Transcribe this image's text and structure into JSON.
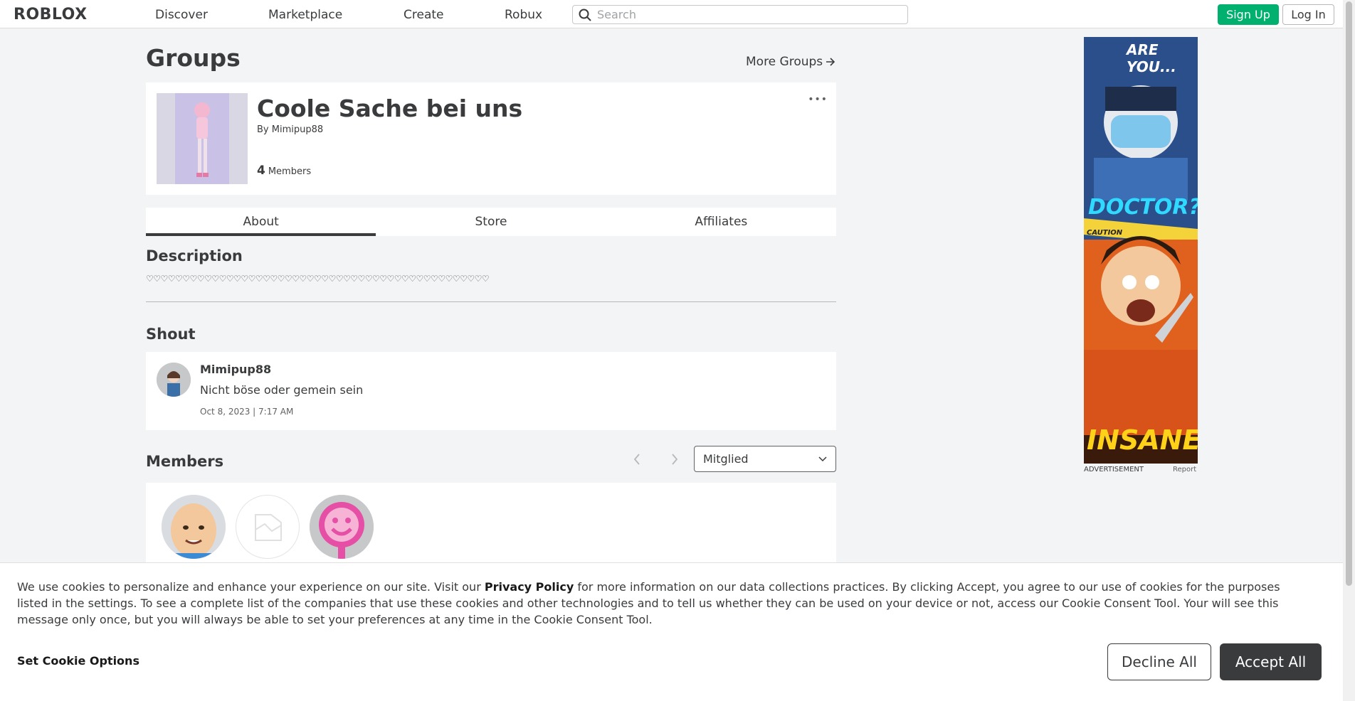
{
  "header": {
    "logo": "ROBLOX",
    "nav": [
      "Discover",
      "Marketplace",
      "Create",
      "Robux"
    ],
    "search_placeholder": "Search",
    "signup_label": "Sign Up",
    "login_label": "Log In"
  },
  "page": {
    "title": "Groups",
    "more_groups": "More Groups"
  },
  "group": {
    "name": "Coole Sache bei uns",
    "by_prefix": "By",
    "owner": "Mimipup88",
    "member_count": "4",
    "members_label": "Members",
    "more_menu": "•••"
  },
  "tabs": [
    "About",
    "Store",
    "Affiliates"
  ],
  "description": {
    "title": "Description",
    "text": "♡♡♡♡♡♡♡♡♡♡♡♡♡♡♡♡♡♡♡♡♡♡♡♡♡♡♡♡♡♡♡♡♡♡♡♡♡♡♡♡♡♡♡♡♡♡♡"
  },
  "shout": {
    "title": "Shout",
    "user": "Mimipup88",
    "message": "Nicht böse oder gemein sein",
    "date": "Oct 8, 2023 | 7:17 AM"
  },
  "members": {
    "title": "Members",
    "role_selected": "Mitglied"
  },
  "ad": {
    "headline_top": "ARE YOU...",
    "headline_mid": "DOCTOR?",
    "headline_bottom": "INSANE?",
    "caution_text": "CAUTION",
    "label": "ADVERTISEMENT",
    "report": "Report"
  },
  "cookie": {
    "text_before": "We use cookies to personalize and enhance your experience on our site. Visit our ",
    "privacy_link": "Privacy Policy",
    "text_after": " for more information on our data collections practices. By clicking Accept, you agree to our use of cookies for the purposes listed in the settings. To see a complete list of the companies that use these cookies and other technologies and to tell us whether they can be used on your device or not, access our Cookie Consent Tool. Your will see this message only once, but you will always be able to set your preferences at any time in the Cookie Consent Tool.",
    "options_label": "Set Cookie Options",
    "decline_label": "Decline All",
    "accept_label": "Accept All"
  },
  "colors": {
    "brand_green": "#00b06f",
    "text_dark": "#393b3d",
    "page_bg": "#f2f4f5"
  }
}
